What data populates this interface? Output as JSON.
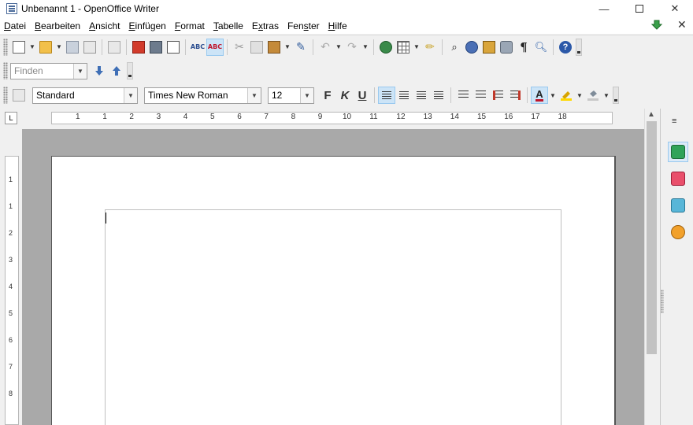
{
  "window": {
    "title": "Unbenannt 1 - OpenOffice Writer",
    "minimize": "—",
    "close": "✕"
  },
  "menu": [
    {
      "pre": "",
      "acc": "D",
      "post": "atei"
    },
    {
      "pre": "",
      "acc": "B",
      "post": "earbeiten"
    },
    {
      "pre": "",
      "acc": "A",
      "post": "nsicht"
    },
    {
      "pre": "",
      "acc": "E",
      "post": "infügen"
    },
    {
      "pre": "",
      "acc": "F",
      "post": "ormat"
    },
    {
      "pre": "",
      "acc": "T",
      "post": "abelle"
    },
    {
      "pre": "E",
      "acc": "x",
      "post": "tras"
    },
    {
      "pre": "Fen",
      "acc": "s",
      "post": "ter"
    },
    {
      "pre": "",
      "acc": "H",
      "post": "ilfe"
    }
  ],
  "find_toolbar": {
    "placeholder": "Finden"
  },
  "formatting": {
    "style": "Standard",
    "font": "Times New Roman",
    "size": "12",
    "bold": "F",
    "italic": "K",
    "underline": "U",
    "font_color_label": "A",
    "font_color": "#c0142a",
    "highlight_color": "#ffd800"
  },
  "ruler": {
    "corner": "L",
    "h_labels": [
      "1",
      "1",
      "2",
      "3",
      "4",
      "5",
      "6",
      "7",
      "8",
      "9",
      "10",
      "11",
      "12",
      "13",
      "14",
      "15",
      "16",
      "17",
      "18"
    ],
    "v_labels": [
      "1",
      "1",
      "2",
      "3",
      "4",
      "5",
      "6",
      "7",
      "8"
    ]
  },
  "help_label": "?",
  "sidebar_menu": "≡"
}
